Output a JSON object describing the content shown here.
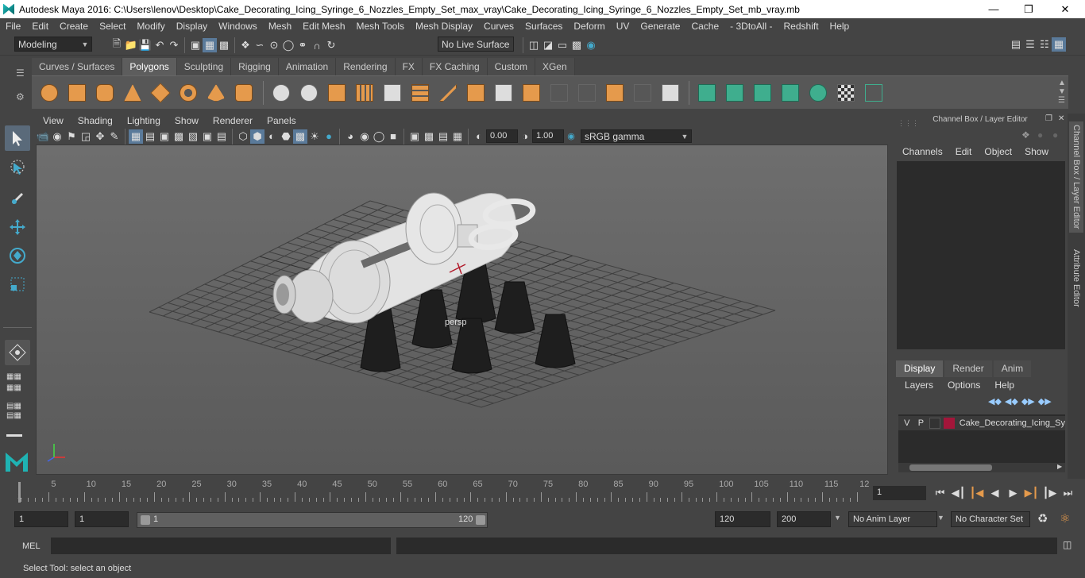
{
  "window": {
    "title": "Autodesk Maya 2016: C:\\Users\\lenov\\Desktop\\Cake_Decorating_Icing_Syringe_6_Nozzles_Empty_Set_max_vray\\Cake_Decorating_Icing_Syringe_6_Nozzles_Empty_Set_mb_vray.mb"
  },
  "menu": [
    "File",
    "Edit",
    "Create",
    "Select",
    "Modify",
    "Display",
    "Windows",
    "Mesh",
    "Edit Mesh",
    "Mesh Tools",
    "Mesh Display",
    "Curves",
    "Surfaces",
    "Deform",
    "UV",
    "Generate",
    "Cache",
    "- 3DtoAll -",
    "Redshift",
    "Help"
  ],
  "status": {
    "mode": "Modeling",
    "live_surface": "No Live Surface"
  },
  "shelf_tabs": [
    "Curves / Surfaces",
    "Polygons",
    "Sculpting",
    "Rigging",
    "Animation",
    "Rendering",
    "FX",
    "FX Caching",
    "Custom",
    "XGen"
  ],
  "shelf_active": "Polygons",
  "viewport_menu": [
    "View",
    "Shading",
    "Lighting",
    "Show",
    "Renderer",
    "Panels"
  ],
  "viewport_fields": {
    "exposure": "0.00",
    "gamma": "1.00",
    "color_space": "sRGB gamma"
  },
  "camera_label": "persp",
  "channel_box": {
    "title": "Channel Box / Layer Editor",
    "menu": [
      "Channels",
      "Edit",
      "Object",
      "Show"
    ]
  },
  "layer_tabs": [
    "Display",
    "Render",
    "Anim"
  ],
  "layer_menu": [
    "Layers",
    "Options",
    "Help"
  ],
  "layer_row": {
    "v": "V",
    "p": "P",
    "name": "Cake_Decorating_Icing_Sy",
    "color": "#a3163a"
  },
  "side_tabs": [
    "Channel Box / Layer Editor",
    "Attribute Editor"
  ],
  "timeline": {
    "ticks": [
      "5",
      "10",
      "15",
      "20",
      "25",
      "30",
      "35",
      "40",
      "45",
      "50",
      "55",
      "60",
      "65",
      "70",
      "75",
      "80",
      "85",
      "90",
      "95",
      "100",
      "105",
      "110",
      "115",
      "12"
    ],
    "start_marker": "1",
    "current_frame": "1"
  },
  "range": {
    "start": "1",
    "playback_start": "1",
    "slider_start": "1",
    "slider_end": "120",
    "playback_end": "120",
    "end": "200",
    "anim_layer": "No Anim Layer",
    "char_set": "No Character Set"
  },
  "cmd": {
    "label": "MEL"
  },
  "statusbar": "Select Tool: select an object"
}
